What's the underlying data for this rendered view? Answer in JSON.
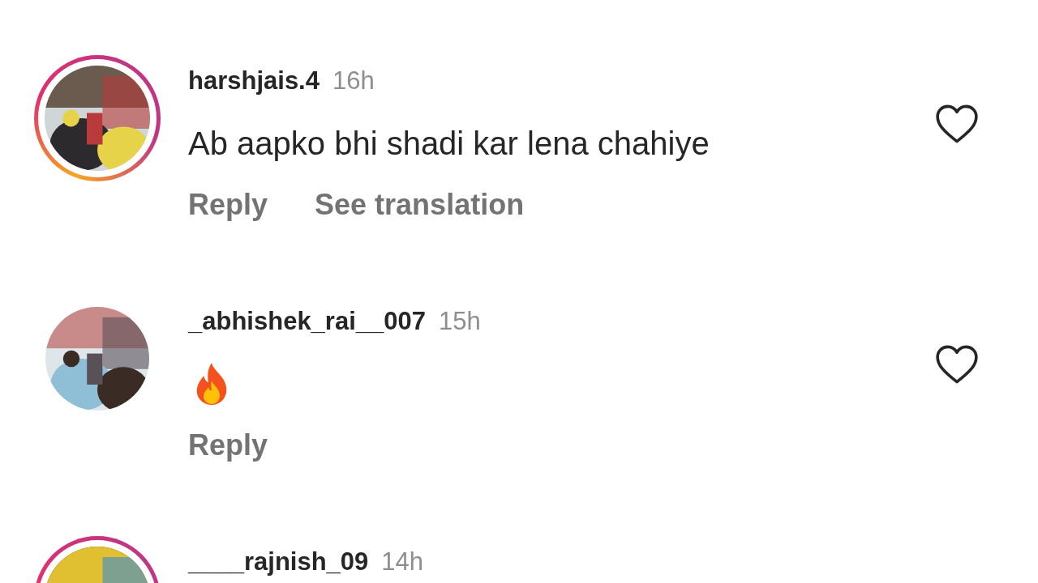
{
  "comments": [
    {
      "username": "harshjais.4",
      "time": "16h",
      "story_ring": true,
      "kind": "text",
      "text": "Ab aapko bhi shadi kar lena chahiye",
      "actions": [
        "Reply",
        "See translation"
      ],
      "liked": false
    },
    {
      "username": "_abhishek_rai__007",
      "time": "15h",
      "story_ring": false,
      "kind": "fire",
      "actions": [
        "Reply"
      ],
      "liked": false
    },
    {
      "username": "____rajnish_09",
      "time": "14h",
      "story_ring": true
    }
  ]
}
